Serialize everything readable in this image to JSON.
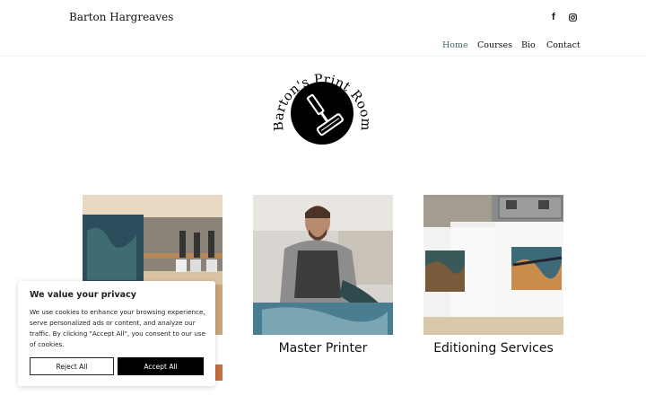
{
  "header": {
    "site_title": "Barton Hargreaves",
    "social": [
      {
        "icon": "facebook-icon",
        "glyph": "f"
      },
      {
        "icon": "instagram-icon",
        "glyph": "◎"
      }
    ],
    "nav": [
      {
        "label": "Home",
        "active": true
      },
      {
        "label": "Courses",
        "active": false
      },
      {
        "label": "Bio",
        "active": false
      },
      {
        "label": "Contact",
        "active": false
      }
    ]
  },
  "logo": {
    "text": "Barton's Print Room",
    "icon": "print-roller-icon"
  },
  "cards": [
    {
      "title": "",
      "image": "studio-prints-on-shelf-photo"
    },
    {
      "title": "Master Printer",
      "image": "printer-at-work-photo"
    },
    {
      "title": "Editioning Services",
      "image": "framed-prints-photo"
    }
  ],
  "cookie": {
    "title": "We value your privacy",
    "text": "We use cookies to enhance your browsing experience, serve personalized ads or content, and analyze our traffic. By clicking \"Accept All\", you consent to our use of cookies.",
    "reject_label": "Reject All",
    "accept_label": "Accept All"
  },
  "colors": {
    "accent": "#3f6b68",
    "button_dark": "#000000"
  }
}
